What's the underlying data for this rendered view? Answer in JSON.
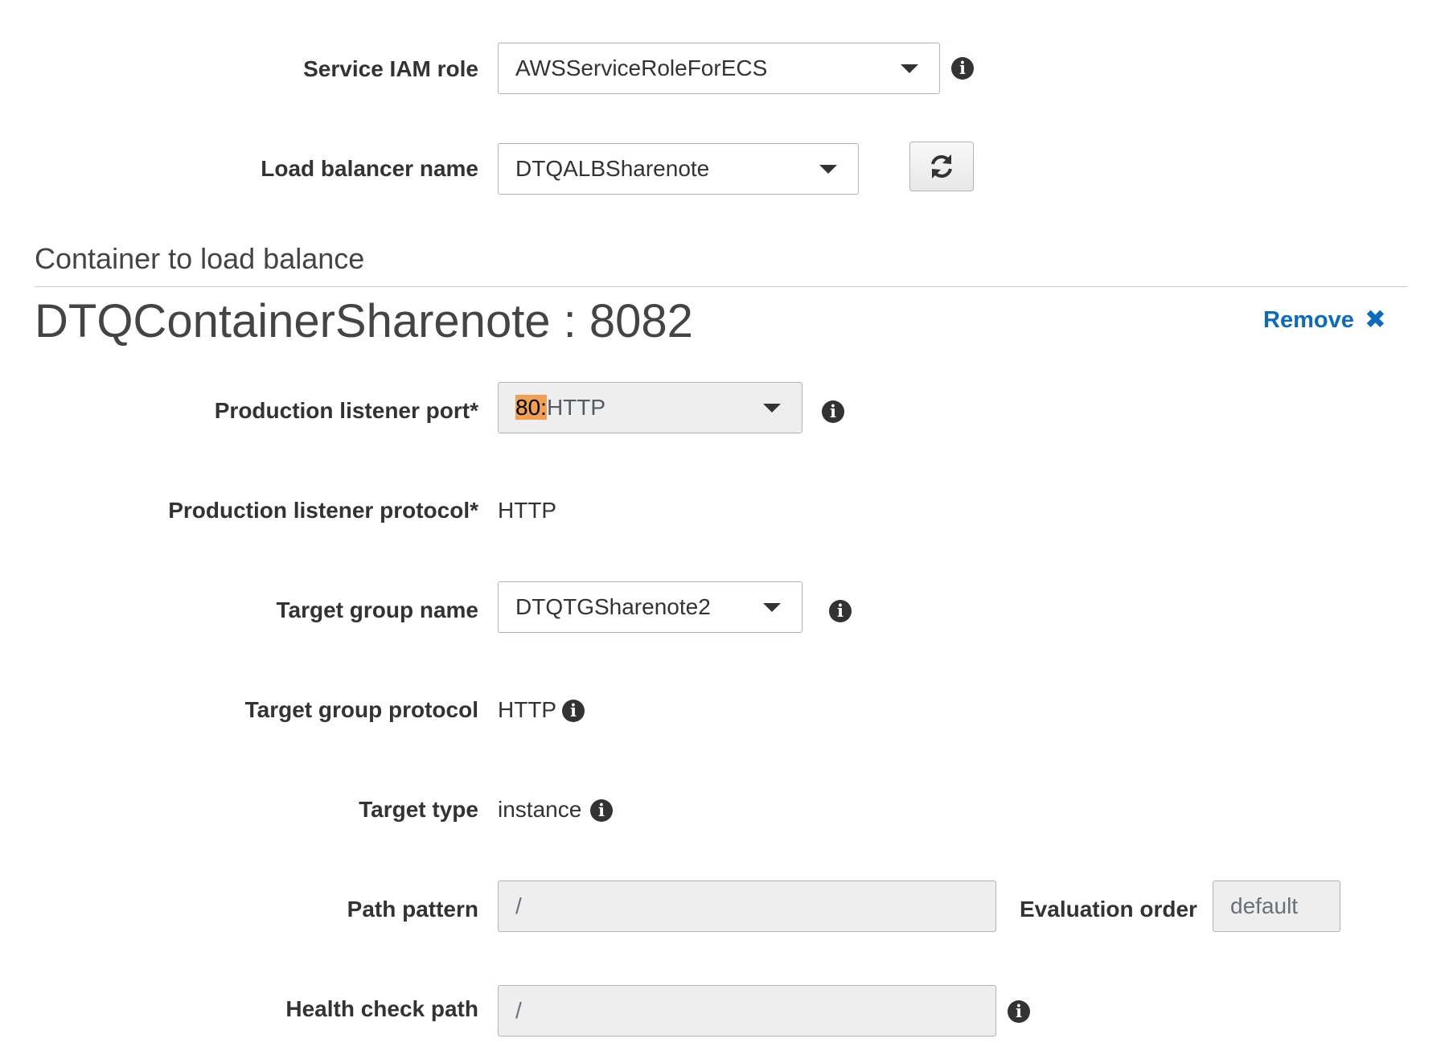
{
  "service_iam_role": {
    "label": "Service IAM role",
    "value": "AWSServiceRoleForECS"
  },
  "load_balancer_name": {
    "label": "Load balancer name",
    "value": "DTQALBSharenote"
  },
  "section": {
    "title": "Container to load balance"
  },
  "container": {
    "heading": "DTQContainerSharenote : 8082",
    "remove_label": "Remove",
    "remove_icon": "✖"
  },
  "production_listener_port": {
    "label": "Production listener port*",
    "value_highlight": "80:",
    "value_rest": "HTTP",
    "highlight_color": "#f0a050"
  },
  "production_listener_protocol": {
    "label": "Production listener protocol*",
    "value": "HTTP"
  },
  "target_group_name": {
    "label": "Target group name",
    "value": "DTQTGSharenote2"
  },
  "target_group_protocol": {
    "label": "Target group protocol",
    "value": "HTTP"
  },
  "target_type": {
    "label": "Target type",
    "value": "instance"
  },
  "path_pattern": {
    "label": "Path pattern",
    "value": "/"
  },
  "evaluation_order": {
    "label": "Evaluation order",
    "value": "default"
  },
  "health_check_path": {
    "label": "Health check path",
    "value": "/"
  },
  "icons": {
    "info": "info-icon",
    "refresh": "refresh-icon",
    "dropdown": "caret-down-icon"
  },
  "colors": {
    "link": "#0d6bbf",
    "text": "#333333",
    "border": "#aab7b8",
    "disabled_bg": "#eeeeee"
  }
}
